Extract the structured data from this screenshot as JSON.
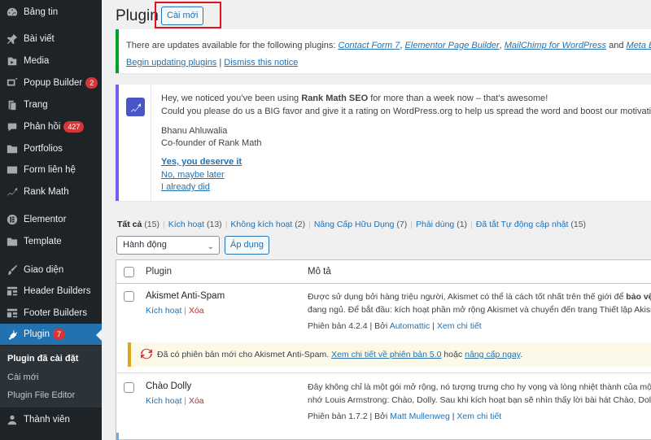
{
  "sidebar": {
    "items": [
      {
        "label": "Bảng tin",
        "icon": "dashboard-icon"
      },
      {
        "label": "Bài viết",
        "icon": "pushpin-icon"
      },
      {
        "label": "Media",
        "icon": "media-icon"
      },
      {
        "label": "Popup Builder",
        "icon": "popup-icon",
        "badge": "2"
      },
      {
        "label": "Trang",
        "icon": "pages-icon"
      },
      {
        "label": "Phản hồi",
        "icon": "comments-icon",
        "badge": "427"
      },
      {
        "label": "Portfolios",
        "icon": "folder-icon"
      },
      {
        "label": "Form liên hệ",
        "icon": "mail-icon"
      },
      {
        "label": "Rank Math",
        "icon": "rankmath-icon"
      },
      {
        "label": "Elementor",
        "icon": "elementor-icon"
      },
      {
        "label": "Template",
        "icon": "folder-icon"
      },
      {
        "label": "Giao diện",
        "icon": "brush-icon"
      },
      {
        "label": "Header Builders",
        "icon": "grid-icon"
      },
      {
        "label": "Footer Builders",
        "icon": "grid-icon"
      },
      {
        "label": "Plugin",
        "icon": "plugin-icon",
        "badge": "7"
      },
      {
        "label": "Thành viên",
        "icon": "user-icon"
      }
    ],
    "submenu": [
      "Plugin đã cài đặt",
      "Cài mới",
      "Plugin File Editor"
    ]
  },
  "header": {
    "title": "Plugin",
    "add_new": "Cài mới"
  },
  "update_notice": {
    "text_before": "There are updates available for the following plugins: ",
    "plugins": [
      "Contact Form 7",
      "Elementor Page Builder",
      "MailChimp for WordPress",
      "Meta Box"
    ],
    "and": " and ",
    "begin": "Begin updating plugins",
    "sep": " | ",
    "dismiss": "Dismiss this notice"
  },
  "rankmath_notice": {
    "line1_a": "Hey, we noticed you’ve been using ",
    "line1_b": "Rank Math SEO",
    "line1_c": " for more than a week now – that’s awesome!",
    "line2": "Could you please do us a BIG favor and give it a rating on WordPress.org to help us spread the word and boost our motivation?",
    "name": "Bhanu Ahluwalia",
    "role": "Co-founder of Rank Math",
    "link_yes": "Yes, you deserve it",
    "link_later": "No, maybe later",
    "link_did": "I already did"
  },
  "filters": [
    {
      "label": "Tất cả",
      "count": "(15)"
    },
    {
      "label": "Kích hoạt",
      "count": "(13)"
    },
    {
      "label": "Không kích hoạt",
      "count": "(2)"
    },
    {
      "label": "Nâng Cấp Hữu Dụng",
      "count": "(7)"
    },
    {
      "label": "Phải dùng",
      "count": "(1)"
    },
    {
      "label": "Đã tắt Tự động cập nhật",
      "count": "(15)"
    }
  ],
  "bulk": {
    "selected": "Hành động",
    "apply": "Áp dụng"
  },
  "table": {
    "col_plugin": "Plugin",
    "col_desc": "Mô tả",
    "rows": [
      {
        "name": "Akismet Anti-Spam",
        "activate": "Kích hoạt",
        "sep": " | ",
        "delete": "Xóa",
        "desc1_a": "Được sử dụng bởi hàng triệu người, Akismet có thể là cách tốt nhất trên thế giới để ",
        "desc1_b": "bảo vệ blo",
        "desc2": "đang ngủ. Để bắt đầu: kích hoạt phần mở rộng Akismet và chuyển đến trang Thiết lập Akismet",
        "version": "Phiên bản 4.2.4",
        "by": " | Bởi ",
        "author": "Automattic",
        "details": "Xem chi tiết",
        "update_text": "Đã có phiên bản mới cho Akismet Anti-Spam. ",
        "update_link": "Xem chi tiết về phiên bản 5.0",
        "update_or": " hoặc ",
        "update_now": "nâng cấp ngay",
        "update_end": "."
      },
      {
        "name": "Chào Dolly",
        "activate": "Kích hoạt",
        "sep": " | ",
        "delete": "Xóa",
        "desc1": "Đây không chỉ là một gói mở rộng, nó tượng trưng cho hy vọng và lòng nhiệt thành của một th",
        "desc2": "nhớ Louis Armstrong: Chào, Dolly. Sau khi kích hoạt bạn sẽ nhìn thấy lời bài hát Chào, Dolly hiể",
        "version": "Phiên bản 1.7.2",
        "by": " | Bởi ",
        "author": "Matt Mullenweg",
        "details": "Xem chi tiết"
      }
    ]
  }
}
